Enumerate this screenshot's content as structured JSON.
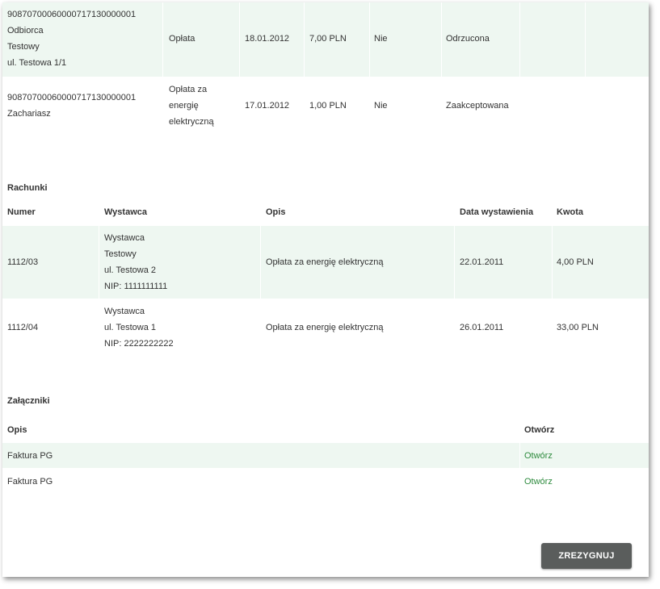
{
  "payments": [
    {
      "account": "90870700060000717130000001",
      "recipient_lines": [
        "Odbiorca",
        "Testowy",
        "ul. Testowa 1/1"
      ],
      "title_lines": [
        "Opłata"
      ],
      "date": "18.01.2012",
      "amount": "7,00 PLN",
      "flag": "Nie",
      "status": "Odrzucona"
    },
    {
      "account": "90870700060000717130000001",
      "recipient_lines": [
        "Zachariasz"
      ],
      "title_lines": [
        "Opłata za",
        "energię",
        "elektryczną"
      ],
      "date": "17.01.2012",
      "amount": "1,00 PLN",
      "flag": "Nie",
      "status": "Zaakceptowana"
    }
  ],
  "bills": {
    "title": "Rachunki",
    "headers": {
      "number": "Numer",
      "issuer": "Wystawca",
      "description": "Opis",
      "issue_date": "Data wystawienia",
      "amount": "Kwota"
    },
    "rows": [
      {
        "number": "1112/03",
        "issuer_lines": [
          "Wystawca",
          "Testowy",
          "ul. Testowa 2",
          "NIP: 1111111111"
        ],
        "description": "Opłata za energię elektryczną",
        "issue_date": "22.01.2011",
        "amount": "4,00 PLN"
      },
      {
        "number": "1112/04",
        "issuer_lines": [
          "Wystawca",
          "ul. Testowa 1",
          "NIP: 2222222222"
        ],
        "description": "Opłata za energię elektryczną",
        "issue_date": "26.01.2011",
        "amount": "33,00 PLN"
      }
    ]
  },
  "attachments": {
    "title": "Załączniki",
    "headers": {
      "description": "Opis",
      "open": "Otwórz"
    },
    "rows": [
      {
        "description": "Faktura PG",
        "open_label": "Otwórz"
      },
      {
        "description": "Faktura PG",
        "open_label": "Otwórz"
      }
    ]
  },
  "actions": {
    "cancel_label": "ZREZYGNUJ"
  },
  "colors": {
    "row_highlight": "#eef7f1",
    "link": "#2e8b3e",
    "button_bg": "#5a5d5c"
  }
}
